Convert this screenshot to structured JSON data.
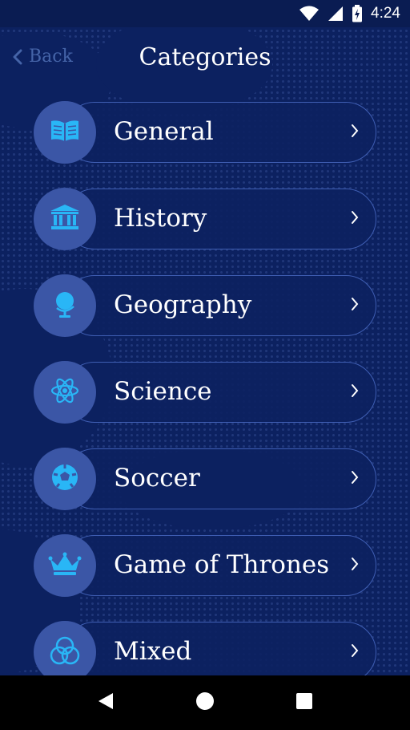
{
  "status_bar": {
    "time": "4:24"
  },
  "header": {
    "back_label": "Back",
    "title": "Categories"
  },
  "categories": [
    {
      "label": "General",
      "icon": "book-icon"
    },
    {
      "label": "History",
      "icon": "museum-icon"
    },
    {
      "label": "Geography",
      "icon": "globe-icon"
    },
    {
      "label": "Science",
      "icon": "atom-icon"
    },
    {
      "label": "Soccer",
      "icon": "soccer-ball-icon"
    },
    {
      "label": "Game of Thrones",
      "icon": "crown-icon"
    },
    {
      "label": "Mixed",
      "icon": "mixed-rings-icon"
    }
  ],
  "colors": {
    "background": "#0c2160",
    "accent": "#29b6f6",
    "circle": "#3b56a6",
    "pill_border": "#3f5eb3",
    "back": "#4564a8"
  }
}
